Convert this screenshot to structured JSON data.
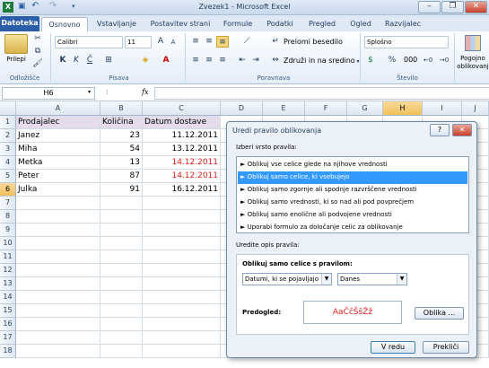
{
  "window": {
    "title": "Zvezek1 - Microsoft Excel",
    "controls": [
      "–",
      "❐",
      "✕"
    ]
  },
  "ribbon_tabs": [
    "Datoteka",
    "Osnovno",
    "Vstavljanje",
    "Postavitev strani",
    "Formule",
    "Podatki",
    "Pregled",
    "Ogled",
    "Razvijalec"
  ],
  "ribbon": {
    "paste_label": "Prilepi",
    "clipboard_group": "Odložišče",
    "font_name": "Calibri",
    "font_size": "11",
    "font_group": "Pisava",
    "bold": "K",
    "italic": "K",
    "underline": "Č",
    "wrap_text": "Prelomi besedilo",
    "merge_center": "Združi in na sredino",
    "alignment_group": "Poravnava",
    "number_format": "Splošno",
    "percent": "%",
    "thousands": "000",
    "number_group": "Število",
    "cond_format_1": "Pogojno",
    "cond_format_2": "oblikovanj"
  },
  "formula_bar": {
    "name_box": "H6",
    "fx": "fx"
  },
  "grid": {
    "columns": [
      "A",
      "B",
      "C",
      "D",
      "E",
      "F",
      "G",
      "H",
      "I",
      "J"
    ],
    "active_column": "H",
    "active_row": "6",
    "rows": [
      {
        "n": "1",
        "a": "Prodajalec",
        "b": "Količina",
        "c": "Datum dostave"
      },
      {
        "n": "2",
        "a": "Janez",
        "b": "23",
        "c": "11.12.2011"
      },
      {
        "n": "3",
        "a": "Miha",
        "b": "54",
        "c": "13.12.2011"
      },
      {
        "n": "4",
        "a": "Metka",
        "b": "13",
        "c": "14.12.2011"
      },
      {
        "n": "5",
        "a": "Peter",
        "b": "87",
        "c": "14.12.2011"
      },
      {
        "n": "6",
        "a": "Julka",
        "b": "91",
        "c": "16.12.2011"
      },
      {
        "n": "7"
      },
      {
        "n": "8"
      },
      {
        "n": "9"
      },
      {
        "n": "10"
      },
      {
        "n": "11"
      },
      {
        "n": "12"
      },
      {
        "n": "13"
      },
      {
        "n": "14"
      },
      {
        "n": "15"
      },
      {
        "n": "16"
      },
      {
        "n": "17"
      },
      {
        "n": "18"
      }
    ],
    "highlight_color": "#e0201c"
  },
  "dialog": {
    "title": "Uredi pravilo oblikovanja",
    "help": "?",
    "close": "✕",
    "select_rule_label": "Izberi vrsto pravila:",
    "rule_types": [
      "► Oblikuj vse celice glede na njihove vrednosti",
      "► Oblikuj samo celice, ki vsebujejo",
      "► Oblikuj samo zgornje ali spodnje razvrščene vrednosti",
      "► Oblikuj samo vrednosti, ki so nad ali pod povprečjem",
      "► Oblikuj samo enolične ali podvojene vrednosti",
      "► Uporabi formulo za določanje celic za oblikovanje"
    ],
    "selected_rule_index": 1,
    "edit_desc_label": "Uredite opis pravila:",
    "format_only_label": "Oblikuj samo celice s pravilom:",
    "condition_value": "Datumi, ki se pojavljajo",
    "period_value": "Danes",
    "preview_label": "Predogled:",
    "preview_text": "AaČčŠšŽž",
    "format_button": "Oblika ...",
    "ok_button": "V redu",
    "cancel_button": "Prekliči"
  }
}
